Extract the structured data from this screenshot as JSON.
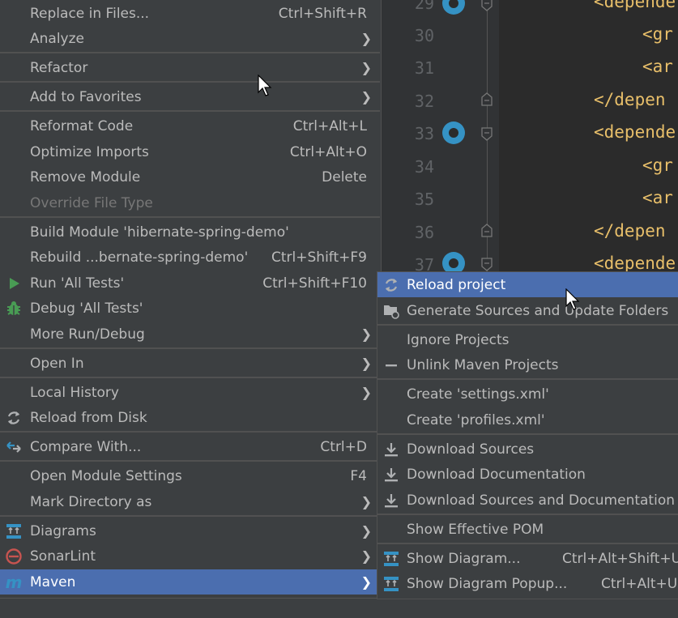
{
  "editor": {
    "lines": [
      {
        "no": "29",
        "code": "<depende"
      },
      {
        "no": "30",
        "code": "<gr"
      },
      {
        "no": "31",
        "code": "<ar"
      },
      {
        "no": "32",
        "code": "</depen"
      },
      {
        "no": "33",
        "code": "<depende"
      },
      {
        "no": "34",
        "code": "<gr"
      },
      {
        "no": "35",
        "code": "<ar"
      },
      {
        "no": "36",
        "code": "</depen"
      },
      {
        "no": "37",
        "code": "<depende"
      }
    ]
  },
  "menu": {
    "items": [
      {
        "label": "Replace in Files...",
        "shortcut": "Ctrl+Shift+R"
      },
      {
        "label": "Analyze",
        "shortcut": ""
      },
      {
        "label": "Refactor",
        "shortcut": ""
      },
      {
        "label": "Add to Favorites",
        "shortcut": ""
      },
      {
        "label": "Reformat Code",
        "shortcut": "Ctrl+Alt+L"
      },
      {
        "label": "Optimize Imports",
        "shortcut": "Ctrl+Alt+O"
      },
      {
        "label": "Remove Module",
        "shortcut": "Delete"
      },
      {
        "label": "Override File Type",
        "shortcut": ""
      },
      {
        "label": "Build Module 'hibernate-spring-demo'",
        "shortcut": ""
      },
      {
        "label": "Rebuild ...bernate-spring-demo'",
        "shortcut": "Ctrl+Shift+F9"
      },
      {
        "label": "Run 'All Tests'",
        "shortcut": "Ctrl+Shift+F10"
      },
      {
        "label": "Debug 'All Tests'",
        "shortcut": ""
      },
      {
        "label": "More Run/Debug",
        "shortcut": ""
      },
      {
        "label": "Open In",
        "shortcut": ""
      },
      {
        "label": "Local History",
        "shortcut": ""
      },
      {
        "label": "Reload from Disk",
        "shortcut": ""
      },
      {
        "label": "Compare With...",
        "shortcut": "Ctrl+D"
      },
      {
        "label": "Open Module Settings",
        "shortcut": "F4"
      },
      {
        "label": "Mark Directory as",
        "shortcut": ""
      },
      {
        "label": "Diagrams",
        "shortcut": ""
      },
      {
        "label": "SonarLint",
        "shortcut": ""
      },
      {
        "label": "Maven",
        "shortcut": ""
      }
    ],
    "icons": {
      "run": "run-triangle-icon",
      "debug": "bug-icon",
      "reload": "reload-icon",
      "compare": "compare-arrows-icon",
      "diagrams": "diagram-icon",
      "sonarlint": "sonarlint-icon",
      "maven": "maven-icon"
    }
  },
  "submenu": {
    "items": [
      {
        "label": "Reload project",
        "shortcut": ""
      },
      {
        "label": "Generate Sources and Update Folders",
        "shortcut": ""
      },
      {
        "label": "Ignore Projects",
        "shortcut": ""
      },
      {
        "label": "Unlink Maven Projects",
        "shortcut": ""
      },
      {
        "label": "Create 'settings.xml'",
        "shortcut": ""
      },
      {
        "label": "Create 'profiles.xml'",
        "shortcut": ""
      },
      {
        "label": "Download Sources",
        "shortcut": ""
      },
      {
        "label": "Download Documentation",
        "shortcut": ""
      },
      {
        "label": "Download Sources and Documentation",
        "shortcut": ""
      },
      {
        "label": "Show Effective POM",
        "shortcut": ""
      },
      {
        "label": "Show Diagram...",
        "shortcut": "Ctrl+Alt+Shift+U"
      },
      {
        "label": "Show Diagram Popup...",
        "shortcut": "Ctrl+Alt+U"
      }
    ]
  },
  "colors": {
    "menu_bg": "#3c3f41",
    "selection": "#4b6eaf",
    "editor_bg": "#2b2b2b",
    "xml_tag": "#e8bf6a",
    "run_green": "#499c54",
    "accent_blue": "#3592c4"
  }
}
